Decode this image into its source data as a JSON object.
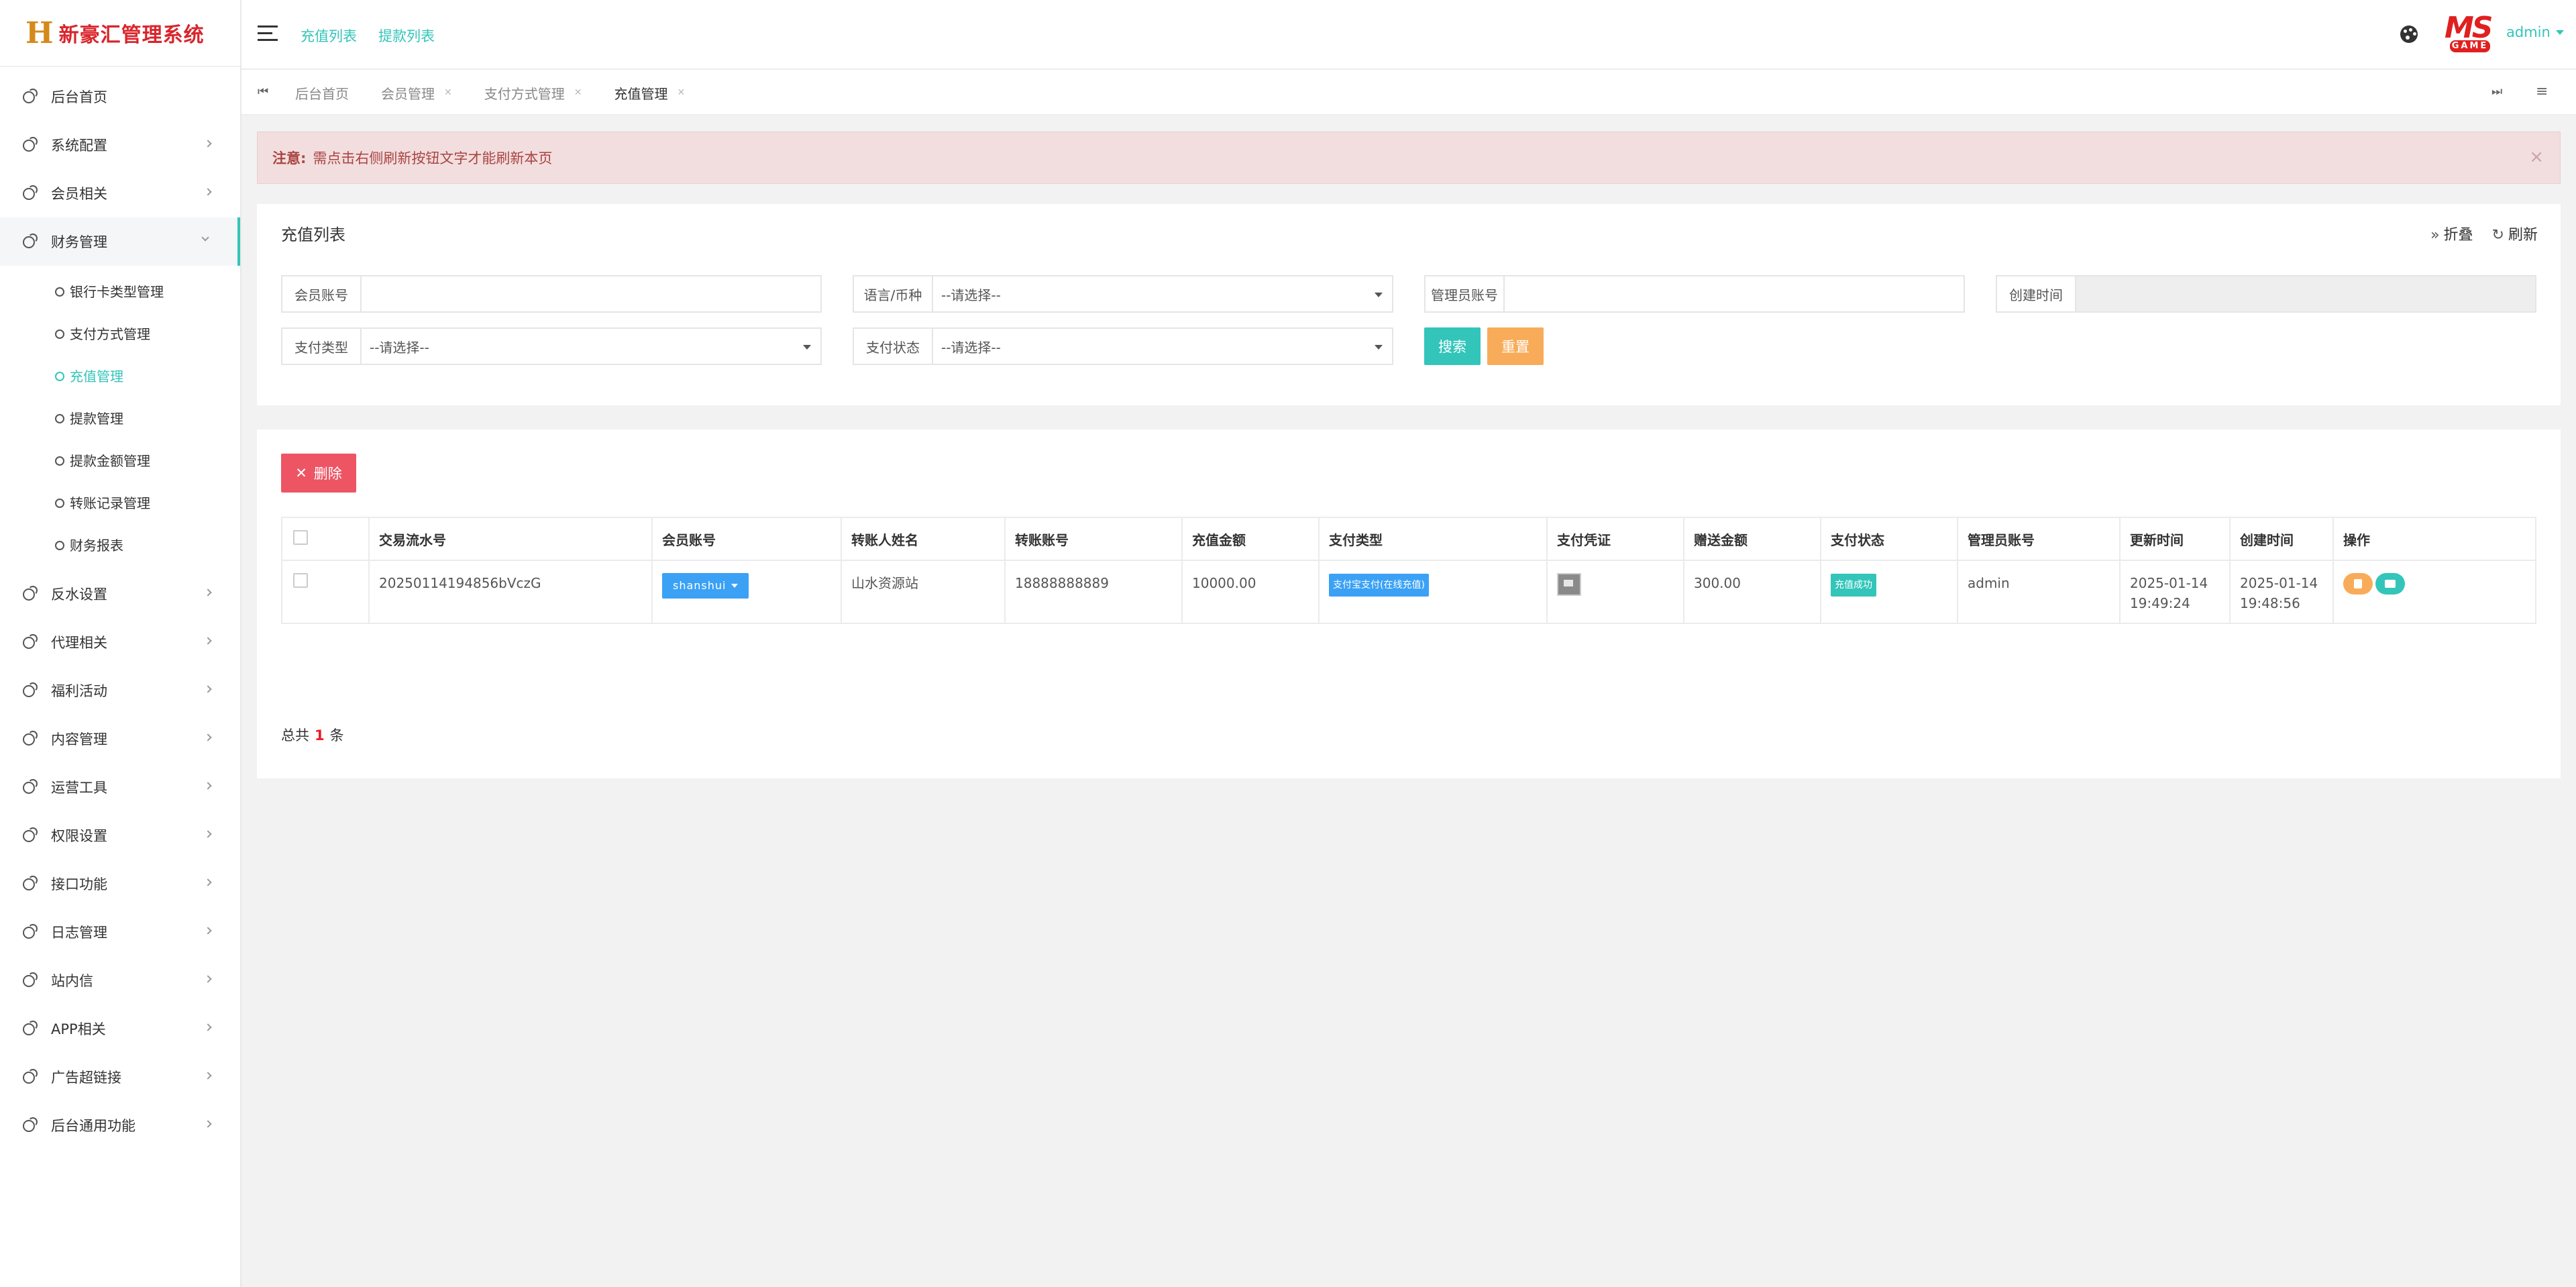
{
  "app": {
    "logo_mark": "H",
    "logo_text": "新豪汇管理系统"
  },
  "sidebar": {
    "items": [
      {
        "label": "后台首页",
        "has_arrow": false
      },
      {
        "label": "系统配置",
        "has_arrow": true
      },
      {
        "label": "会员相关",
        "has_arrow": true
      },
      {
        "label": "财务管理",
        "has_arrow": true,
        "open": true
      },
      {
        "label": "反水设置",
        "has_arrow": true
      },
      {
        "label": "代理相关",
        "has_arrow": true
      },
      {
        "label": "福利活动",
        "has_arrow": true
      },
      {
        "label": "内容管理",
        "has_arrow": true
      },
      {
        "label": "运营工具",
        "has_arrow": true
      },
      {
        "label": "权限设置",
        "has_arrow": true
      },
      {
        "label": "接口功能",
        "has_arrow": true
      },
      {
        "label": "日志管理",
        "has_arrow": true
      },
      {
        "label": "站内信",
        "has_arrow": true
      },
      {
        "label": "APP相关",
        "has_arrow": true
      },
      {
        "label": "广告超链接",
        "has_arrow": true
      },
      {
        "label": "后台通用功能",
        "has_arrow": true
      }
    ],
    "sub_items": [
      {
        "label": "银行卡类型管理"
      },
      {
        "label": "支付方式管理"
      },
      {
        "label": "充值管理",
        "active": true
      },
      {
        "label": "提款管理"
      },
      {
        "label": "提款金额管理"
      },
      {
        "label": "转账记录管理"
      },
      {
        "label": "财务报表"
      }
    ]
  },
  "header": {
    "links": [
      "充值列表",
      "提款列表"
    ],
    "avatar_text": "MS",
    "avatar_sub": "GAME",
    "user": "admin"
  },
  "tabs": {
    "first_icon": "⏮",
    "items": [
      "后台首页",
      "会员管理",
      "支付方式管理",
      "充值管理"
    ],
    "last_icon": "⏭",
    "menu_icon": "≡"
  },
  "alert": {
    "prefix": "注意:",
    "message": "需点击右侧刷新按钮文字才能刷新本页",
    "close": "×"
  },
  "search": {
    "title": "充值列表",
    "collapse_label": "折叠",
    "refresh_label": "刷新",
    "fields": {
      "member_account": {
        "label": "会员账号",
        "value": ""
      },
      "language": {
        "label": "语言/币种",
        "value": "--请选择--"
      },
      "admin_account": {
        "label": "管理员账号",
        "value": ""
      },
      "created_time": {
        "label": "创建时间",
        "value": ""
      },
      "pay_type": {
        "label": "支付类型",
        "value": "--请选择--"
      },
      "pay_status": {
        "label": "支付状态",
        "value": "--请选择--"
      }
    },
    "search_button": "搜索",
    "reset_button": "重置"
  },
  "table": {
    "delete_button": "删除",
    "columns": [
      "交易流水号",
      "会员账号",
      "转账人姓名",
      "转账账号",
      "充值金额",
      "支付类型",
      "支付凭证",
      "赠送金额",
      "支付状态",
      "管理员账号",
      "更新时间",
      "创建时间",
      "操作"
    ],
    "rows": [
      {
        "serial": "20250114194856bVczG",
        "member": "shanshui",
        "payer_name": "山水资源站",
        "payer_account": "18888888889",
        "amount": "10000.00",
        "pay_type": "支付宝支付(在线充值)",
        "bonus": "300.00",
        "status": "充值成功",
        "admin": "admin",
        "updated_date": "2025-01-14",
        "updated_time": "19:49:24",
        "created_date": "2025-01-14",
        "created_time": "19:48:56"
      }
    ],
    "total_prefix": "总共",
    "total_count": "1",
    "total_suffix": "条"
  },
  "colors": {
    "accent": "#33c5ba",
    "danger": "#ed5565",
    "warning": "#f8ac59",
    "info": "#3ba1f5"
  }
}
